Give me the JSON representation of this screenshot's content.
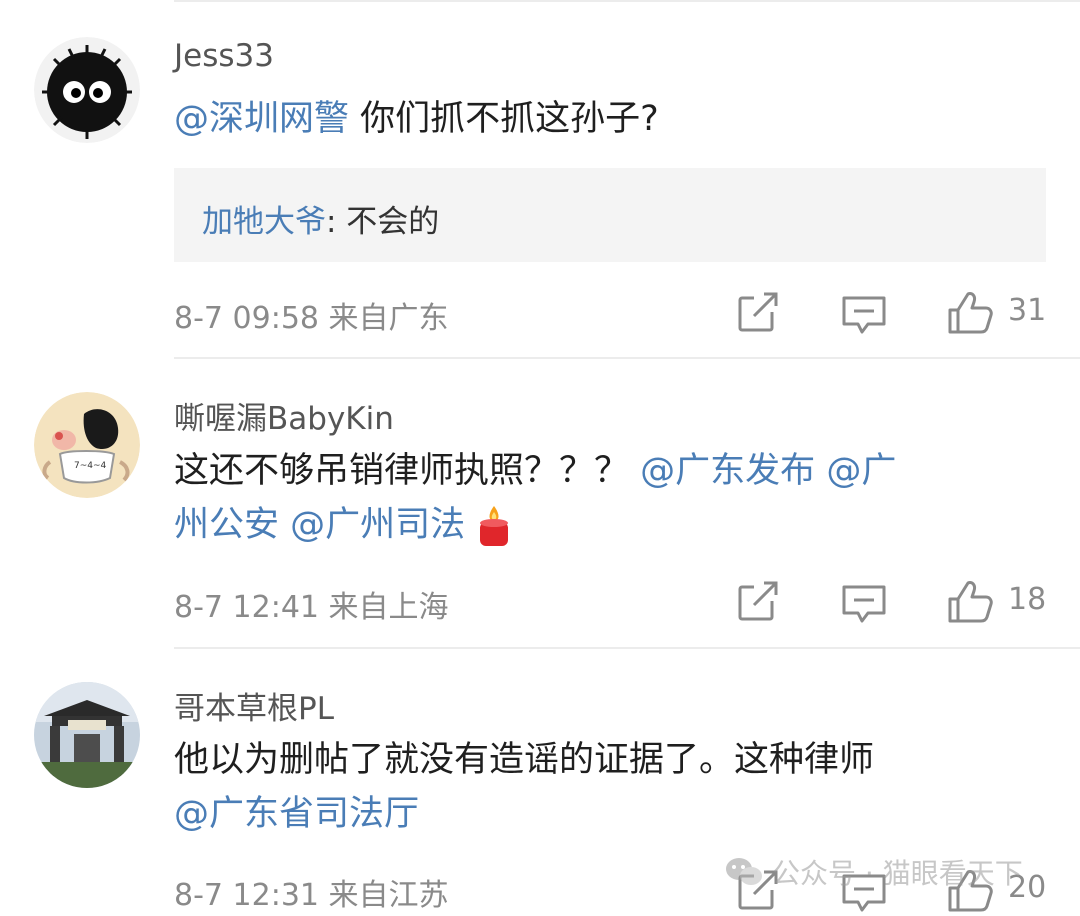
{
  "comments": [
    {
      "username": "Jess33",
      "mention": "@深圳网警",
      "text": " 你们抓不抓这孙子?",
      "reply_author": "加牠大爷",
      "reply_text": ": 不会的",
      "time": "8-7 09:58",
      "location": "来自广东",
      "likes": "31"
    },
    {
      "username": "嘶喔漏BabyKin",
      "text_prefix": "这还不够吊销律师执照？？？",
      "mention1": "@广东发布",
      "mention2a": "@广",
      "mention2b": "州公安",
      "mention3": "@广州司法",
      "time": "8-7 12:41",
      "location": "来自上海",
      "likes": "18"
    },
    {
      "username": "哥本草根PL",
      "text": "他以为删帖了就没有造谣的证据了。这种律师",
      "mention": "@广东省司法厅",
      "time": "8-7 12:31",
      "location": "来自江苏",
      "likes": "20"
    }
  ],
  "watermark": {
    "text": "公众号 · 猫眼看天下"
  },
  "colors": {
    "mention": "#4a7db6",
    "meta": "#8a8a8a",
    "reply_bg": "#f4f4f4"
  },
  "icons": [
    "share-icon",
    "comment-icon",
    "like-icon",
    "candle-emoji",
    "wechat-icon"
  ]
}
